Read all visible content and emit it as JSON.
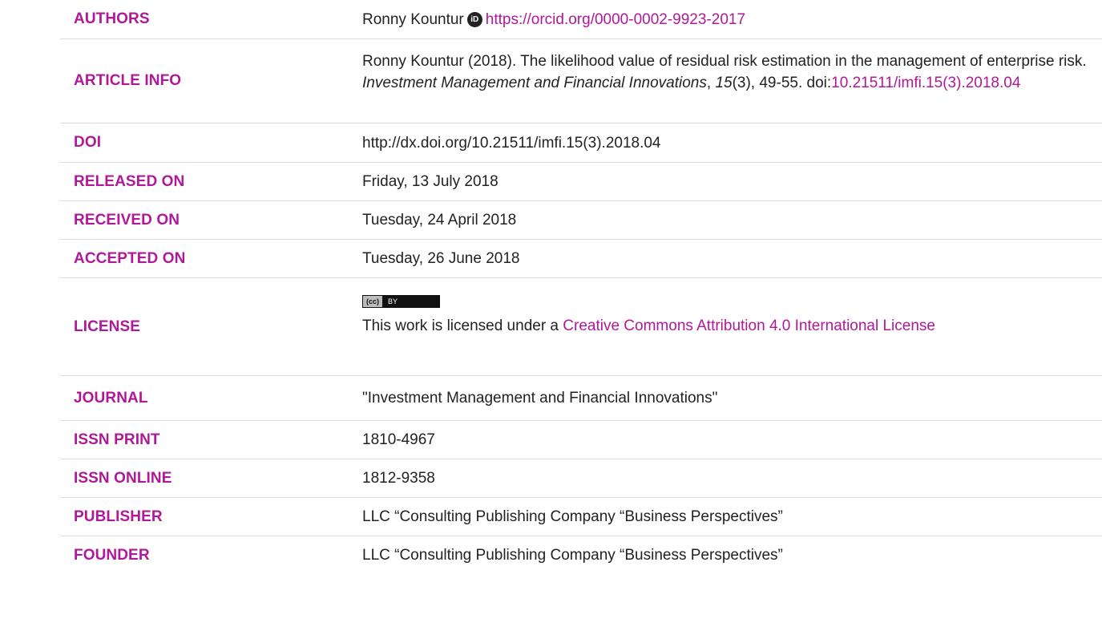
{
  "rows": {
    "authors": {
      "label": "AUTHORS",
      "name": "Ronny Kountur",
      "orcid_url": "https://orcid.org/0000-0002-9923-2017"
    },
    "article_info": {
      "label": "ARTICLE INFO",
      "citation_text": "Ronny Kountur (2018). The likelihood value of residual risk estimation in the management of enterprise risk. ",
      "journal_italic": "Investment Management and Financial Innovations",
      "sep": ", ",
      "volume_italic": "15",
      "issue_pages": "(3), 49-55. doi:",
      "doi_link": "10.21511/imfi.15(3).2018.04"
    },
    "doi": {
      "label": "DOI",
      "value": "http://dx.doi.org/10.21511/imfi.15(3).2018.04"
    },
    "released_on": {
      "label": "RELEASED ON",
      "value": "Friday, 13 July 2018"
    },
    "received_on": {
      "label": "RECEIVED ON",
      "value": "Tuesday, 24 April 2018"
    },
    "accepted_on": {
      "label": "ACCEPTED ON",
      "value": "Tuesday, 26 June 2018"
    },
    "license": {
      "label": "LICENSE",
      "badge_cc": "(cc)",
      "badge_by": "BY",
      "text": "This work is licensed under a ",
      "link": "Creative Commons Attribution 4.0 International License"
    },
    "journal": {
      "label": "JOURNAL",
      "value": "\"Investment Management and Financial Innovations\""
    },
    "issn_print": {
      "label": "ISSN PRINT",
      "value": "1810-4967"
    },
    "issn_online": {
      "label": "ISSN ONLINE",
      "value": "1812-9358"
    },
    "publisher": {
      "label": "PUBLISHER",
      "value": "LLC “Consulting Publishing Company “Business Perspectives”"
    },
    "founder": {
      "label": "FOUNDER",
      "value": "LLC “Consulting Publishing Company “Business Perspectives”"
    }
  },
  "colors": {
    "accent": "#b0189a",
    "text": "#222222",
    "divider": "#dcdcdc"
  }
}
